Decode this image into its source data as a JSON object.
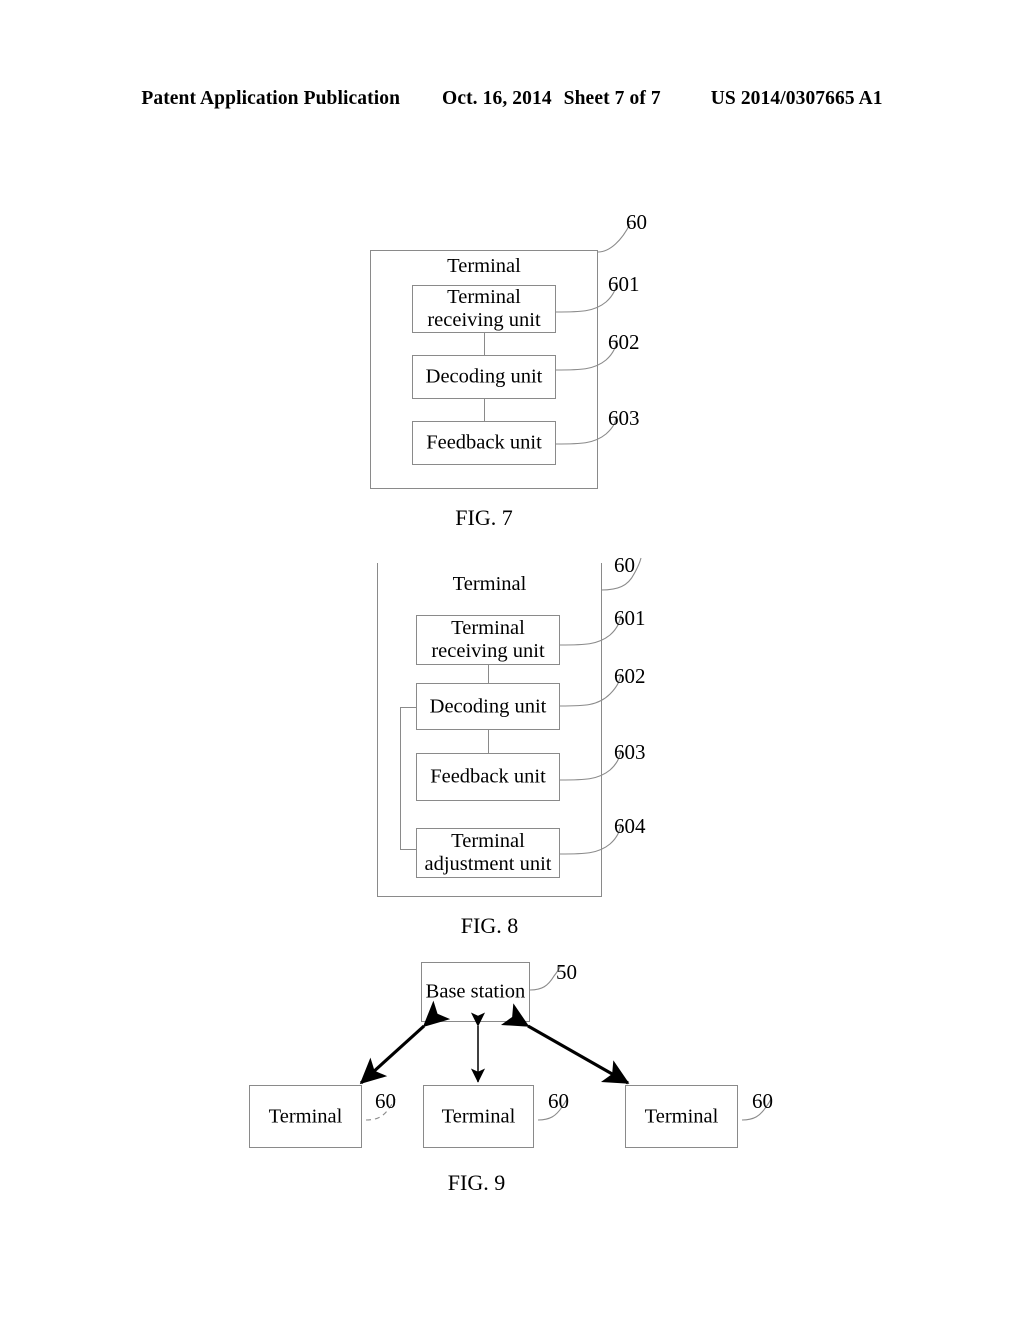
{
  "header": {
    "publication": "Patent Application Publication",
    "date": "Oct. 16, 2014",
    "sheet": "Sheet 7 of 7",
    "patent_number": "US 2014/0307665 A1"
  },
  "figures": [
    {
      "caption": "FIG. 7",
      "outer": {
        "title": "Terminal",
        "ref": "60"
      },
      "blocks": [
        {
          "label": "Terminal\nreceiving unit",
          "ref": "601"
        },
        {
          "label": "Decoding unit",
          "ref": "602"
        },
        {
          "label": "Feedback unit",
          "ref": "603"
        }
      ]
    },
    {
      "caption": "FIG. 8",
      "outer": {
        "title": "Terminal",
        "ref": "60"
      },
      "blocks": [
        {
          "label": "Terminal\nreceiving unit",
          "ref": "601"
        },
        {
          "label": "Decoding unit",
          "ref": "602"
        },
        {
          "label": "Feedback unit",
          "ref": "603"
        },
        {
          "label": "Terminal\nadjustment unit",
          "ref": "604"
        }
      ]
    },
    {
      "caption": "FIG. 9",
      "base_station": {
        "label": "Base station",
        "ref": "50"
      },
      "terminals": [
        {
          "label": "Terminal",
          "ref": "60"
        },
        {
          "label": "Terminal",
          "ref": "60"
        },
        {
          "label": "Terminal",
          "ref": "60"
        }
      ]
    }
  ],
  "colors": {
    "line": "#8a8a8a",
    "arrow": "#000000",
    "text": "#000000",
    "background": "#ffffff"
  }
}
